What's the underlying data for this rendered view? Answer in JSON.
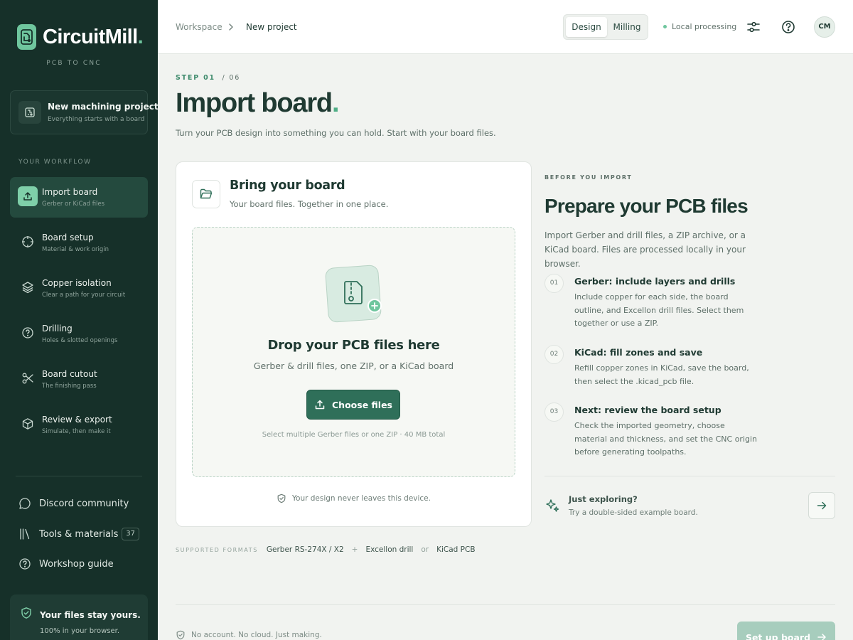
{
  "brand": {
    "name": "CircuitMill",
    "dot": ".",
    "tagline": "PCB TO CNC"
  },
  "project_card": {
    "title": "New machining project",
    "subtitle": "Everything starts with a board"
  },
  "workflow": {
    "label": "YOUR WORKFLOW",
    "items": [
      {
        "title": "Import board",
        "subtitle": "Gerber or KiCad files",
        "icon": "upload-icon",
        "active": true
      },
      {
        "title": "Board setup",
        "subtitle": "Material & work origin",
        "icon": "crosshair-icon"
      },
      {
        "title": "Copper isolation",
        "subtitle": "Clear a path for your circuit",
        "icon": "layers-icon"
      },
      {
        "title": "Drilling",
        "subtitle": "Holes & slotted openings",
        "icon": "drill-icon"
      },
      {
        "title": "Board cutout",
        "subtitle": "The finishing pass",
        "icon": "scissors-icon"
      },
      {
        "title": "Review & export",
        "subtitle": "Simulate, then make it",
        "icon": "box-icon"
      }
    ]
  },
  "side_links": [
    {
      "label": "Discord community",
      "icon": "chat-icon"
    },
    {
      "label": "Tools & materials",
      "icon": "library-icon",
      "badge": "37"
    },
    {
      "label": "Workshop guide",
      "icon": "help-circle-icon"
    }
  ],
  "privacy": {
    "title": "Your files stay yours.",
    "subtitle": "100% in your browser."
  },
  "topbar": {
    "breadcrumb": [
      "Workspace",
      "New project"
    ],
    "mode_tabs": [
      "Design",
      "Milling"
    ],
    "active_mode": "Design",
    "status": "Local processing",
    "avatar_initials": "CM"
  },
  "page": {
    "step_current": "STEP 01",
    "step_total": "/ 06",
    "title": "Import board",
    "title_dot": ".",
    "subtitle": "Turn your PCB design into something you can hold. Start with your board files."
  },
  "import_card": {
    "title": "Bring your board",
    "subtitle": "Your board files. Together in one place.",
    "dropzone": {
      "title": "Drop your PCB files here",
      "subtitle": "Gerber & drill files, one ZIP, or a KiCad board",
      "button": "Choose files",
      "note": "Select multiple Gerber files or one ZIP · 40 MB total"
    },
    "footer": "Your design never leaves this device."
  },
  "formats": {
    "label": "SUPPORTED FORMATS",
    "items": [
      "Gerber RS-274X / X2",
      "Excellon drill",
      "KiCad PCB"
    ],
    "separators": [
      "+",
      "or"
    ]
  },
  "prepare": {
    "label": "BEFORE YOU IMPORT",
    "title": "Prepare your PCB files",
    "description": "Import Gerber and drill files, a ZIP archive, or a KiCad board. Files are processed locally in your browser.",
    "tips": [
      {
        "num": "01",
        "title": "Gerber: include layers and drills",
        "body": "Include copper for each side, the board outline, and Excellon drill files. Select them together or use a ZIP."
      },
      {
        "num": "02",
        "title": "KiCad: fill zones and save",
        "body": "Refill copper zones in KiCad, save the board, then select the .kicad_pcb file."
      },
      {
        "num": "03",
        "title": "Next: review the board setup",
        "body": "Check the imported geometry, choose material and thickness, and set the CNC origin before generating toolpaths."
      }
    ],
    "explore": {
      "title": "Just exploring?",
      "subtitle": "Try a double-sided example board."
    }
  },
  "footer": {
    "note": "No account. No cloud. Just making.",
    "next_button": "Set up board"
  },
  "colors": {
    "sidebar_bg": "#163029",
    "accent": "#6fc69e",
    "primary_button": "#2f6f59",
    "disabled_button": "#a7cdbd"
  }
}
